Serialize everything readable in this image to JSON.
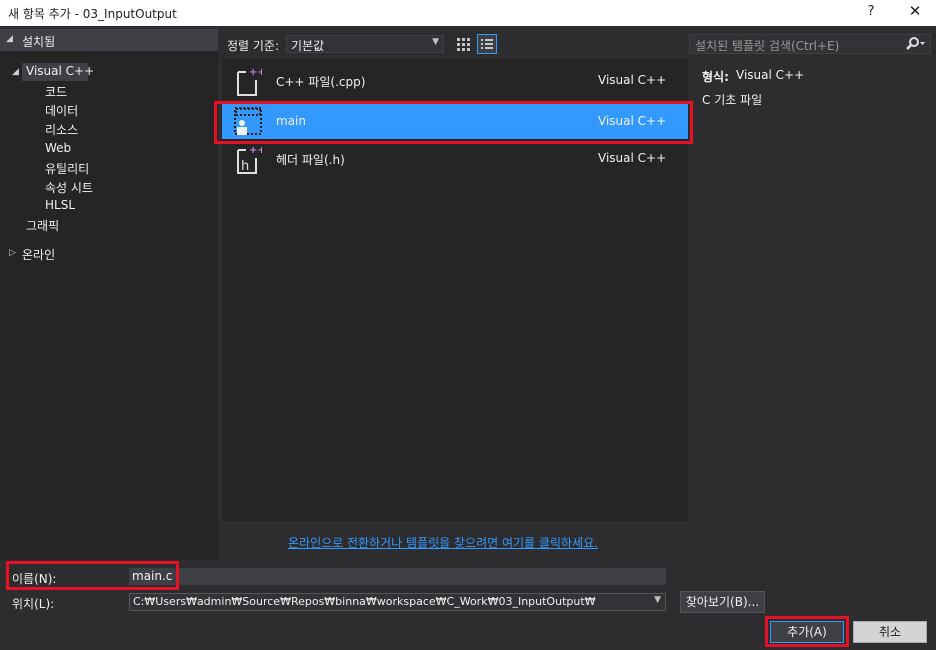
{
  "window": {
    "title": "새 항목 추가 - 03_InputOutput",
    "help": "?",
    "close": "✕"
  },
  "tree": {
    "installed": "설치됨",
    "visual_cpp": "Visual C++",
    "children": [
      "코드",
      "데이터",
      "리소스",
      "Web",
      "유틸리티",
      "속성 시트",
      "HLSL"
    ],
    "graphics": "그래픽",
    "online": "온라인"
  },
  "toolbar": {
    "sort_label": "정렬 기준:",
    "sort_value": "기본값",
    "search_placeholder": "설치된 템플릿 검색(Ctrl+E)"
  },
  "templates": [
    {
      "name": "C++ 파일(.cpp)",
      "lang": "Visual C++"
    },
    {
      "name": "main",
      "lang": "Visual C++"
    },
    {
      "name": "헤더 파일(.h)",
      "lang": "Visual C++"
    }
  ],
  "info": {
    "type_label": "형식:",
    "type_value": "Visual C++",
    "description": "C 기초 파일"
  },
  "online_link": "온라인으로 전환하거나 템플릿을 찾으려면 여기를 클릭하세요.",
  "form": {
    "name_label": "이름(N):",
    "name_value": "main.c",
    "location_label": "위치(L):",
    "location_value": "C:₩Users₩admin₩Source₩Repos₩binna₩workspace₩C_Work₩03_InputOutput₩",
    "browse": "찾아보기(B)...",
    "add": "추가(A)",
    "cancel": "취소"
  },
  "colors": {
    "accent": "#3399ff",
    "highlight_box": "#e81123",
    "background": "#2d2d30"
  }
}
